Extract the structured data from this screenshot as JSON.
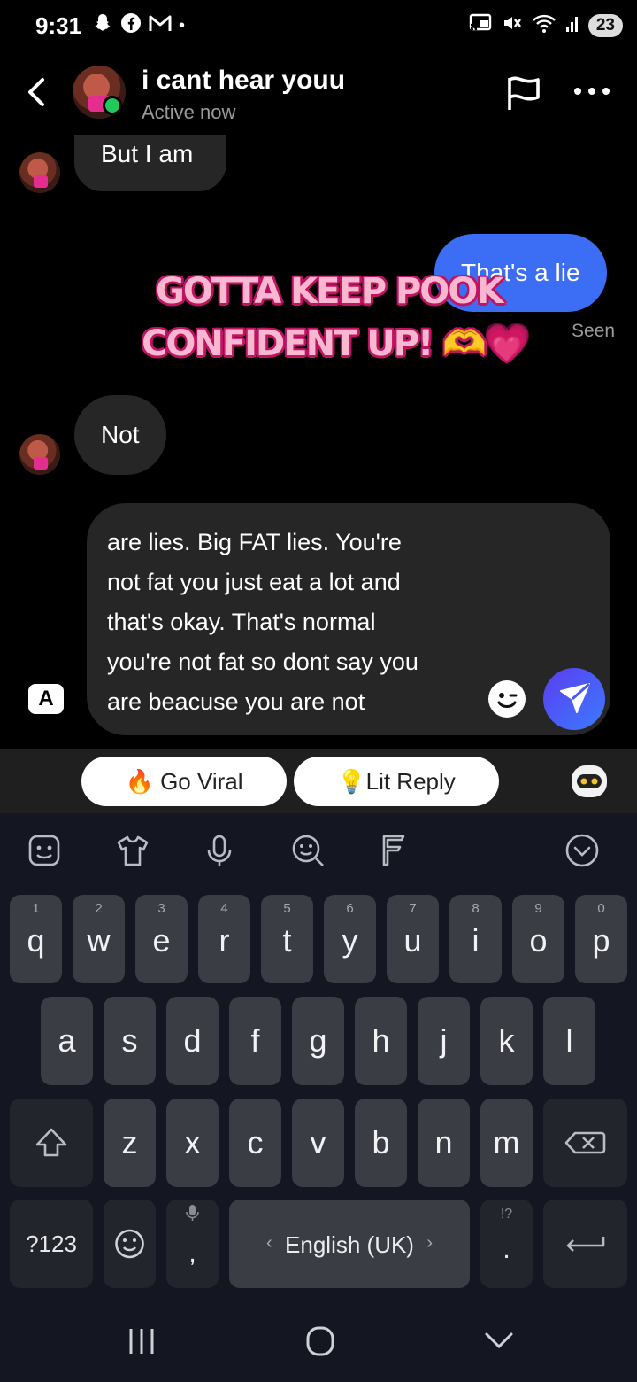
{
  "status_bar": {
    "time": "9:31",
    "battery": "23"
  },
  "header": {
    "contact_name": "i cant hear youu",
    "contact_status": "Active now"
  },
  "messages": [
    {
      "direction": "in",
      "text": "But I am"
    },
    {
      "direction": "out",
      "text": "That's a lie",
      "receipt": "Seen"
    },
    {
      "direction": "in",
      "text": "Not"
    }
  ],
  "overlay_sticker": {
    "line1": "GOTTA KEEP POOK",
    "line2": "CONFIDENT UP! 🫶💗"
  },
  "composer": {
    "keyboard_toggle": "A",
    "lines": [
      "are lies. Big FAT lies. You're",
      "not fat you just eat a lot and",
      "that's okay. That's normal",
      "you're not fat so dont say you",
      "are beacuse you are not"
    ]
  },
  "suggestions": {
    "go_viral": "🔥 Go Viral",
    "lit_reply": "💡Lit Reply"
  },
  "keyboard": {
    "row1": [
      {
        "letter": "q",
        "num": "1"
      },
      {
        "letter": "w",
        "num": "2"
      },
      {
        "letter": "e",
        "num": "3"
      },
      {
        "letter": "r",
        "num": "4"
      },
      {
        "letter": "t",
        "num": "5"
      },
      {
        "letter": "y",
        "num": "6"
      },
      {
        "letter": "u",
        "num": "7"
      },
      {
        "letter": "i",
        "num": "8"
      },
      {
        "letter": "o",
        "num": "9"
      },
      {
        "letter": "p",
        "num": "0"
      }
    ],
    "row2": [
      "a",
      "s",
      "d",
      "f",
      "g",
      "h",
      "j",
      "k",
      "l"
    ],
    "row3": [
      "z",
      "x",
      "c",
      "v",
      "b",
      "n",
      "m"
    ],
    "symbols_label": "?123",
    "comma": ",",
    "period": ".",
    "period_hint": "!?",
    "space_label": "English (UK)",
    "space_left": "‹",
    "space_right": "›"
  },
  "colors": {
    "outgoing_bubble": "#3b6ef5",
    "incoming_bubble": "#262626",
    "online": "#20c95a",
    "sticker_fill": "#f9b8cf",
    "sticker_stroke": "#c01363"
  }
}
